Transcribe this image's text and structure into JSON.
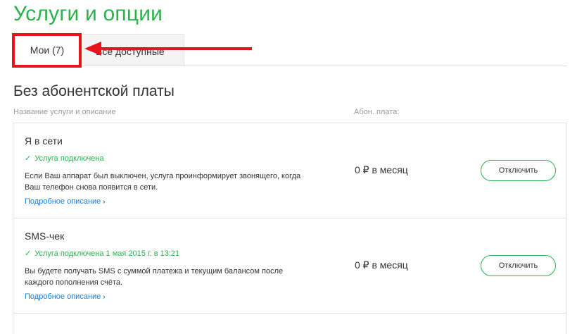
{
  "page": {
    "title": "Услуги и опции"
  },
  "tabs": [
    {
      "label": "Мои (7)",
      "active": true
    },
    {
      "label": "Все доступные",
      "active": false
    }
  ],
  "section": {
    "title": "Без абонентской платы",
    "columns": {
      "name": "Название услуги и описание",
      "fee": "Абон. плата:"
    }
  },
  "services": [
    {
      "name": "Я в сети",
      "status": "Услуга подключена",
      "description": "Если Ваш аппарат был выключен, услуга проинформирует звонящего, когда Ваш телефон снова появится в сети.",
      "link": "Подробное описание",
      "price": "0 ₽ в месяц",
      "button": "Отключить"
    },
    {
      "name": "SMS-чек",
      "status": "Услуга подключена 1 мая 2015 г. в 13:21",
      "description": "Вы будете получать SMS с суммой платежа и текущим балансом после каждого пополнения счёта.",
      "link": "Подробное описание",
      "price": "0 ₽ в месяц",
      "button": "Отключить"
    }
  ],
  "colors": {
    "accent": "#29b34a",
    "link": "#1e7fd1",
    "annotation": "#e8141c"
  },
  "icons": {
    "status": "check-icon",
    "link": "chevron-right-icon",
    "annotation": "arrow-left-icon"
  }
}
